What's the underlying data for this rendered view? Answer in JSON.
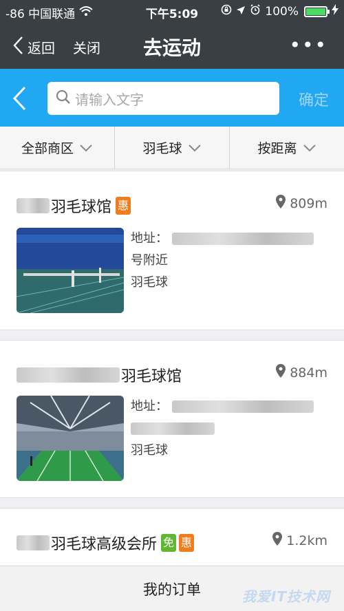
{
  "statusbar": {
    "carrier": "-86 中国联通",
    "time": "下午5:09",
    "battery": "100%"
  },
  "navbar": {
    "back_label": "返回",
    "close_label": "关闭",
    "title": "去运动",
    "more": "•••"
  },
  "search": {
    "placeholder": "请输入文字",
    "confirm_label": "确定"
  },
  "filters": [
    {
      "label": "全部商区"
    },
    {
      "label": "羽毛球"
    },
    {
      "label": "按距离"
    }
  ],
  "venues": [
    {
      "name": "羽毛球馆",
      "tags": [
        "惠"
      ],
      "distance": "809m",
      "address_label": "地址：",
      "address_suffix": "号附近",
      "category": "羽毛球"
    },
    {
      "name": "羽毛球馆",
      "tags": [],
      "distance": "884m",
      "address_label": "地址：",
      "address_suffix": "",
      "category": "羽毛球"
    },
    {
      "name": "羽毛球高级会所",
      "tags": [
        "免",
        "惠"
      ],
      "distance": "1.2km"
    }
  ],
  "bottom": {
    "orders_label": "我的订单"
  },
  "watermark": "我爱IT技术网",
  "colors": {
    "topbar": "#3a3f44",
    "accent": "#20a9f2",
    "tag_hui": "#f07d1d",
    "tag_mian": "#5fb832"
  }
}
